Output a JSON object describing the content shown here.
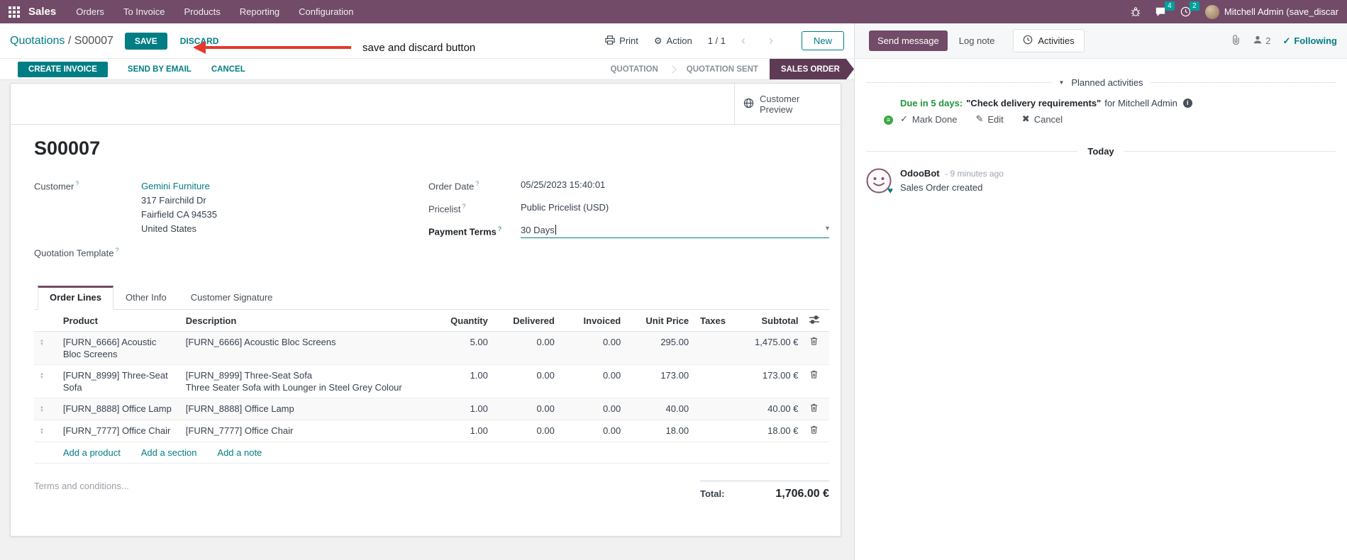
{
  "navbar": {
    "app_name": "Sales",
    "menus": [
      "Orders",
      "To Invoice",
      "Products",
      "Reporting",
      "Configuration"
    ],
    "messages_count": "4",
    "activities_count": "2",
    "user_name": "Mitchell Admin (save_discar"
  },
  "breadcrumb": {
    "parent": "Quotations",
    "separator": " / ",
    "current": "S00007",
    "save_label": "SAVE",
    "discard_label": "DISCARD"
  },
  "annotation": {
    "text": "save and discard button"
  },
  "control_panel": {
    "print_label": "Print",
    "action_label": "Action",
    "pager": "1 / 1",
    "new_label": "New"
  },
  "statusbar": {
    "create_invoice": "CREATE INVOICE",
    "send_by_email": "SEND BY EMAIL",
    "cancel": "CANCEL",
    "stage_quotation": "QUOTATION",
    "stage_quotation_sent": "QUOTATION SENT",
    "stage_sales_order": "SALES ORDER"
  },
  "sheet": {
    "customer_preview": "Customer Preview",
    "title": "S00007",
    "fields": {
      "customer_label": "Customer",
      "customer_name": "Gemini Furniture",
      "address_line1": "317 Fairchild Dr",
      "address_line2": "Fairfield CA 94535",
      "address_line3": "United States",
      "quotation_template_label": "Quotation Template",
      "order_date_label": "Order Date",
      "order_date": "05/25/2023 15:40:01",
      "pricelist_label": "Pricelist",
      "pricelist": "Public Pricelist (USD)",
      "payment_terms_label": "Payment Terms",
      "payment_terms": "30 Days"
    },
    "tabs": [
      "Order Lines",
      "Other Info",
      "Customer Signature"
    ],
    "table": {
      "columns": [
        "Product",
        "Description",
        "Quantity",
        "Delivered",
        "Invoiced",
        "Unit Price",
        "Taxes",
        "Subtotal"
      ],
      "rows": [
        {
          "product": "[FURN_6666] Acoustic Bloc Screens",
          "description": "[FURN_6666] Acoustic Bloc Screens",
          "quantity": "5.00",
          "delivered": "0.00",
          "invoiced": "0.00",
          "unit_price": "295.00",
          "taxes": "",
          "subtotal": "1,475.00 €"
        },
        {
          "product": "[FURN_8999] Three-Seat Sofa",
          "description": "[FURN_8999] Three-Seat Sofa",
          "description2": "Three Seater Sofa with Lounger in Steel Grey Colour",
          "quantity": "1.00",
          "delivered": "0.00",
          "invoiced": "0.00",
          "unit_price": "173.00",
          "taxes": "",
          "subtotal": "173.00 €"
        },
        {
          "product": "[FURN_8888] Office Lamp",
          "description": "[FURN_8888] Office Lamp",
          "quantity": "1.00",
          "delivered": "0.00",
          "invoiced": "0.00",
          "unit_price": "40.00",
          "taxes": "",
          "subtotal": "40.00 €"
        },
        {
          "product": "[FURN_7777] Office Chair",
          "description": "[FURN_7777] Office Chair",
          "quantity": "1.00",
          "delivered": "0.00",
          "invoiced": "0.00",
          "unit_price": "18.00",
          "taxes": "",
          "subtotal": "18.00 €"
        }
      ],
      "add_product": "Add a product",
      "add_section": "Add a section",
      "add_note": "Add a note"
    },
    "terms_placeholder": "Terms and conditions...",
    "total_label": "Total:",
    "total_value": "1,706.00 €"
  },
  "chatter": {
    "send_message": "Send message",
    "log_note": "Log note",
    "activities_tab": "Activities",
    "followers_count": "2",
    "following": "Following",
    "planned_header": "Planned activities",
    "activity_due": "Due in 5 days:",
    "activity_summary": "\"Check delivery requirements\"",
    "activity_for": "for Mitchell Admin",
    "mark_done": "Mark Done",
    "edit": "Edit",
    "cancel": "Cancel",
    "today": "Today",
    "message_author": "OdooBot",
    "message_time": "- 9 minutes ago",
    "message_body": "Sales Order created"
  },
  "icons": {
    "gear": "⚙",
    "caret_down": "▾",
    "chevrons": "‹ ›",
    "check": "✓",
    "pencil": "✎",
    "cross": "✖",
    "question": "?",
    "menu": "≡",
    "heart": "♥",
    "triangle_up": "▲",
    "triangle_down": "▼",
    "info": "i"
  },
  "colors": {
    "brand_purple": "#714B67",
    "accent_teal": "#017e84",
    "stage_active_bg": "#5f3a55",
    "badge_teal": "#00a09d",
    "edited_value_blue": "#2e72d2",
    "success_green": "#21953c",
    "annotation_red": "#e6382c"
  }
}
